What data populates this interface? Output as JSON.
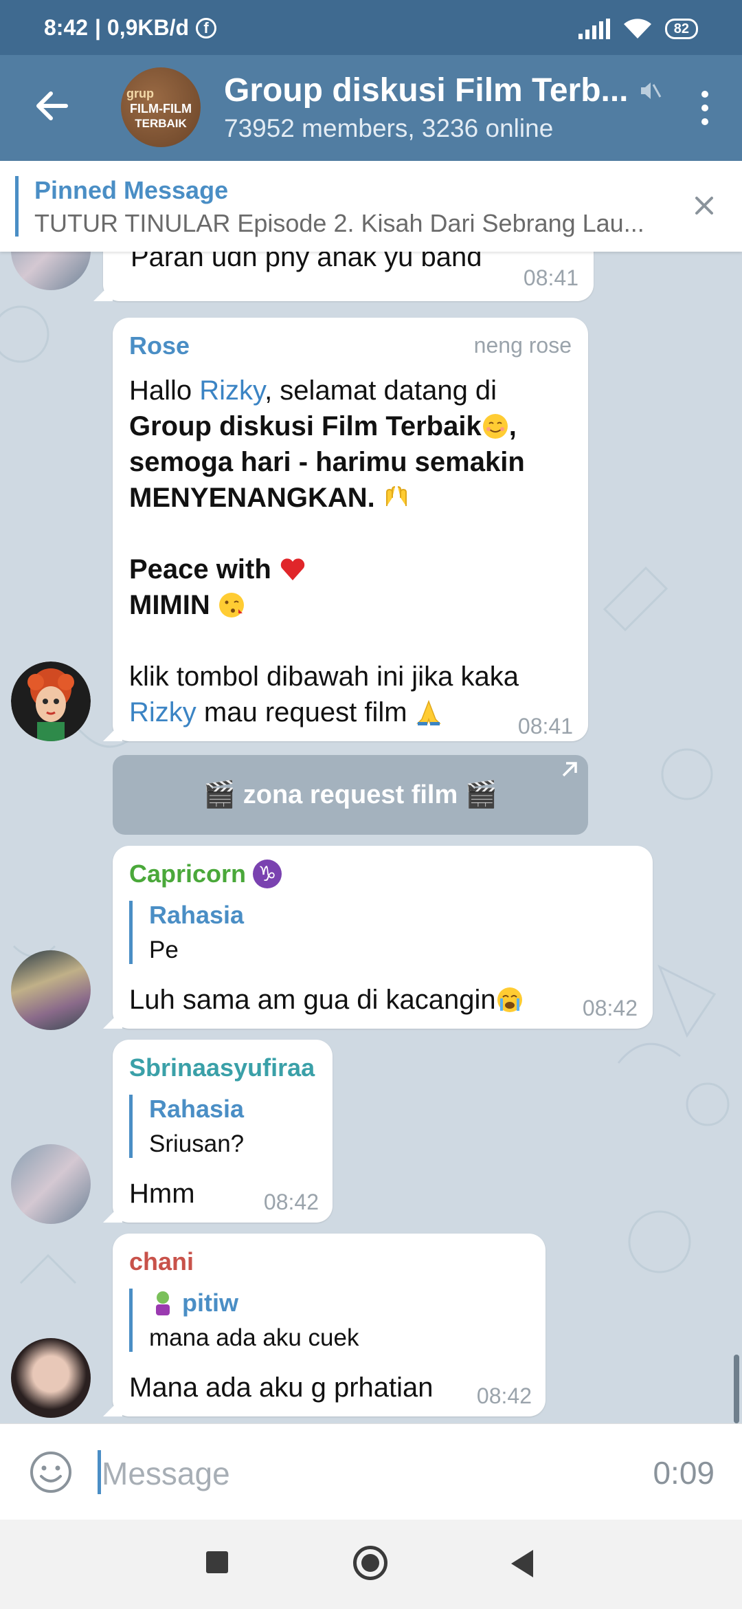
{
  "status_bar": {
    "time": "8:42",
    "data_rate": "| 0,9KB/d",
    "battery": "82"
  },
  "header": {
    "title": "Group diskusi Film Terb...",
    "members": "73952 members, 3236 online",
    "avatar_line1": "grup",
    "avatar_line2": "FILM-FILM",
    "avatar_line3": "TERBAIK"
  },
  "pinned": {
    "label": "Pinned Message",
    "text": "TUTUR TINULAR Episode 2. Kisah Dari Sebrang Lau..."
  },
  "messages": {
    "m0": {
      "text_partial": "Parah udh pny anak yu band",
      "time": "08:41"
    },
    "m1": {
      "sender": "Rose",
      "sender_title": "neng rose",
      "hallo": "Hallo ",
      "rizky": "Rizky",
      "welcome": ", selamat datang di",
      "group_name": "Group diskusi Film Terbaik",
      "line3": "semoga hari - harimu semakin",
      "line4": "MENYENANGKAN.",
      "peace": "Peace with",
      "mimin": "MIMIN",
      "klik": "klik tombol dibawah ini jika kaka",
      "rizky2": "Rizky",
      "request": " mau request film",
      "time": "08:41"
    },
    "bot_button": {
      "label": "🎬 zona request  film 🎬"
    },
    "m2": {
      "sender": "Capricorn",
      "reply_name": "Rahasia",
      "reply_text": "Pe",
      "text": "Luh sama am gua di kacangin",
      "time": "08:42"
    },
    "m3": {
      "sender": "Sbrinaasyufiraa",
      "reply_name": "Rahasia",
      "reply_text": "Sriusan?",
      "text": "Hmm",
      "time": "08:42"
    },
    "m4": {
      "sender": "chani",
      "reply_name": "pitiw",
      "reply_text": "mana ada aku cuek",
      "text": "Mana ada aku g prhatian",
      "time": "08:42"
    }
  },
  "input": {
    "placeholder": "Message",
    "timer": "0:09"
  },
  "colors": {
    "header": "#517da2",
    "status": "#3f6a90",
    "accent": "#4a8ec5",
    "rose": "#4a8ec5",
    "capricorn": "#4aa83a",
    "sbrina": "#3aa0a8",
    "chani": "#c8524a"
  }
}
